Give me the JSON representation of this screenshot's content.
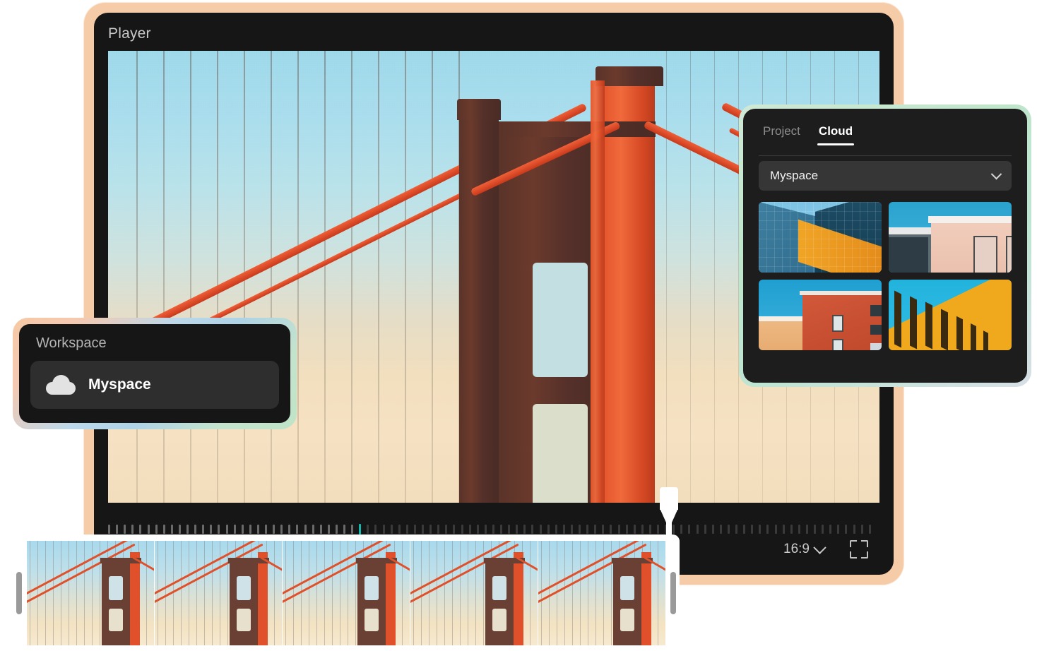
{
  "player": {
    "title": "Player",
    "aspect_ratio_label": "16:9",
    "aspect_chevron_icon": "chevron-down-icon",
    "fullscreen_icon": "fullscreen-icon",
    "playhead_icon": "playhead-marker",
    "ruler": {
      "tick_count": 98,
      "marker_index": 32,
      "marker_color": "#12b9b0"
    },
    "preview_subject": "golden-gate-bridge"
  },
  "cloud_panel": {
    "tabs": [
      {
        "label": "Project",
        "active": false
      },
      {
        "label": "Cloud",
        "active": true
      }
    ],
    "workspace_select": {
      "value": "Myspace",
      "chevron_icon": "chevron-down-icon"
    },
    "thumbnails": [
      {
        "name": "blue-glass-office-building"
      },
      {
        "name": "pink-modern-facade"
      },
      {
        "name": "orange-brick-apartment"
      },
      {
        "name": "yellow-colonnade-building"
      }
    ],
    "border_color": "#bfe6cb"
  },
  "workspace_panel": {
    "title": "Workspace",
    "items": [
      {
        "label": "Myspace",
        "icon": "cloud-icon",
        "selected": true
      }
    ],
    "border_gradient": [
      "#f6c9a4",
      "#aed2e6",
      "#bfe4c6"
    ]
  },
  "timeline": {
    "clip_name": "golden-gate-bridge-clip",
    "frame_count": 5,
    "left_handle_icon": "trim-handle-left",
    "right_handle_icon": "trim-handle-right"
  },
  "colors": {
    "frame_border": "#f6cba8",
    "panel_bg": "#1d1d1d",
    "player_bg": "#161616",
    "accent_teal": "#12b9b0",
    "text_primary": "#ffffff",
    "text_muted": "#8d8d8d"
  }
}
